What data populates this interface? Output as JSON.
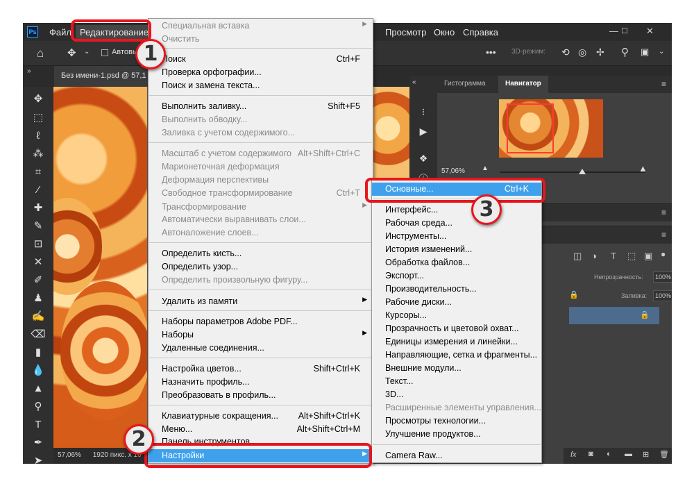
{
  "menubar": {
    "app_logo": "Ps",
    "items": [
      "Файл",
      "Редактирование",
      "Просмотр",
      "Окно",
      "Справка"
    ]
  },
  "window_controls": [
    "minimize-icon",
    "maximize-icon",
    "close-icon"
  ],
  "options_bar": {
    "home_icon": "home-icon",
    "move_icon": "move-icon",
    "autoselect_label": "Автовы",
    "mode_3d_label": "3D-режим:"
  },
  "document_tab": {
    "title": "Без имени-1.psd @ 57,1"
  },
  "status_bar": {
    "zoom": "57,06%",
    "info": "1920 пикс. x 10"
  },
  "navigator_panel": {
    "tabs": [
      "Гистограмма",
      "Навигатор"
    ],
    "active_tab": "Навигатор",
    "zoom": "57,06%"
  },
  "layers_panel": {
    "opacity_label": "Непрозрачность:",
    "opacity_value": "100%",
    "fill_label": "Заливка:",
    "fill_value": "100%"
  },
  "edit_menu": {
    "items": [
      {
        "label": "Специальная вставка",
        "disabled": true,
        "submenu": true
      },
      {
        "label": "Очистить",
        "disabled": true
      },
      {
        "label": "Поиск",
        "shortcut": "Ctrl+F"
      },
      {
        "label": "Проверка орфографии..."
      },
      {
        "label": "Поиск и замена текста..."
      },
      {
        "label": "Выполнить заливку...",
        "shortcut": "Shift+F5"
      },
      {
        "label": "Выполнить обводку...",
        "disabled": true
      },
      {
        "label": "Заливка с учетом содержимого...",
        "disabled": true
      },
      {
        "label": "Масштаб с учетом содержимого",
        "shortcut": "Alt+Shift+Ctrl+C",
        "disabled": true
      },
      {
        "label": "Марионеточная деформация",
        "disabled": true
      },
      {
        "label": "Деформация перспективы",
        "disabled": true
      },
      {
        "label": "Свободное трансформирование",
        "shortcut": "Ctrl+T",
        "disabled": true
      },
      {
        "label": "Трансформирование",
        "disabled": true,
        "submenu": true
      },
      {
        "label": "Автоматически выравнивать слои...",
        "disabled": true
      },
      {
        "label": "Автоналожение слоев...",
        "disabled": true
      },
      {
        "label": "Определить кисть..."
      },
      {
        "label": "Определить узор..."
      },
      {
        "label": "Определить произвольную фигуру...",
        "disabled": true
      },
      {
        "label": "Удалить из памяти",
        "submenu": true
      },
      {
        "label": "Наборы параметров Adobe PDF..."
      },
      {
        "label": "Наборы",
        "submenu": true
      },
      {
        "label": "Удаленные соединения..."
      },
      {
        "label": "Настройка цветов...",
        "shortcut": "Shift+Ctrl+K"
      },
      {
        "label": "Назначить профиль..."
      },
      {
        "label": "Преобразовать в профиль..."
      },
      {
        "label": "Клавиатурные сокращения...",
        "shortcut": "Alt+Shift+Ctrl+K"
      },
      {
        "label": "Меню...",
        "shortcut": "Alt+Shift+Ctrl+M"
      },
      {
        "label": "Панель инструментов..."
      },
      {
        "label": "Настройки",
        "submenu": true,
        "highlighted": true
      }
    ]
  },
  "settings_submenu": {
    "items": [
      {
        "label": "Основные...",
        "shortcut": "Ctrl+K",
        "highlighted": true
      },
      {
        "label": "Интерфейс..."
      },
      {
        "label": "Рабочая среда..."
      },
      {
        "label": "Инструменты..."
      },
      {
        "label": "История изменений..."
      },
      {
        "label": "Обработка файлов..."
      },
      {
        "label": "Экспорт..."
      },
      {
        "label": "Производительность..."
      },
      {
        "label": "Рабочие диски..."
      },
      {
        "label": "Курсоры..."
      },
      {
        "label": "Прозрачность и цветовой охват..."
      },
      {
        "label": "Единицы измерения и линейки..."
      },
      {
        "label": "Направляющие, сетка и фрагменты..."
      },
      {
        "label": "Внешние модули..."
      },
      {
        "label": "Текст..."
      },
      {
        "label": "3D..."
      },
      {
        "label": "Расширенные элементы управления...",
        "disabled": true
      },
      {
        "label": "Просмотры технологии..."
      },
      {
        "label": "Улучшение продуктов..."
      },
      {
        "label": "Camera Raw..."
      }
    ]
  },
  "callouts": [
    {
      "number": "1"
    },
    {
      "number": "2"
    },
    {
      "number": "3"
    }
  ],
  "colors": {
    "callout_red": "#e8161c",
    "menu_highlight": "#3fa1ec",
    "app_dark": "#2b2b2b"
  }
}
